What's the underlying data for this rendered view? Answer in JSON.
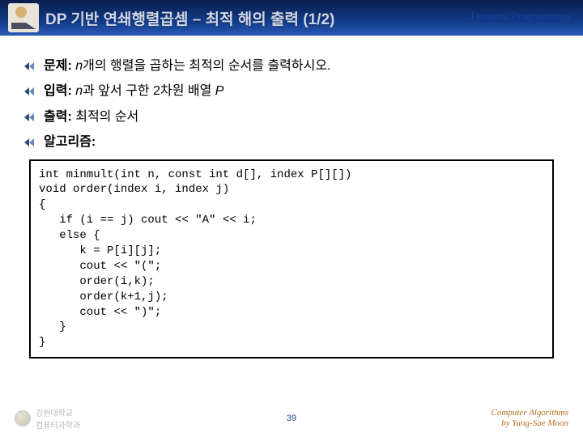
{
  "header": {
    "title": "DP 기반 연쇄행렬곱셈 – 최적 해의 출력 (1/2)",
    "right": "Dynamic Programming"
  },
  "bullets": {
    "b1_label": "문제:",
    "b1_n": "n",
    "b1_rest": "개의 행렬을 곱하는 최적의 순서를 출력하시오.",
    "b2_label": "입력:",
    "b2_n": "n",
    "b2_mid": "과 앞서 구한 2차원 배열 ",
    "b2_P": "P",
    "b3_label": "출력:",
    "b3_rest": " 최적의 순서",
    "b4_label": "알고리즘:"
  },
  "code": "int minmult(int n, const int d[], index P[][])\nvoid order(index i, index j)\n{\n   if (i == j) cout << \"A\" << i;\n   else {\n      k = P[i][j];\n      cout << \"(\";\n      order(i,k);\n      order(k+1,j);\n      cout << \")\";\n   }\n}",
  "footer": {
    "logo_text": "강원대학교\n컴퓨터과학과",
    "page": "39",
    "credit_l1": "Computer Algorithms",
    "credit_l2": "by Yang-Sae Moon"
  }
}
